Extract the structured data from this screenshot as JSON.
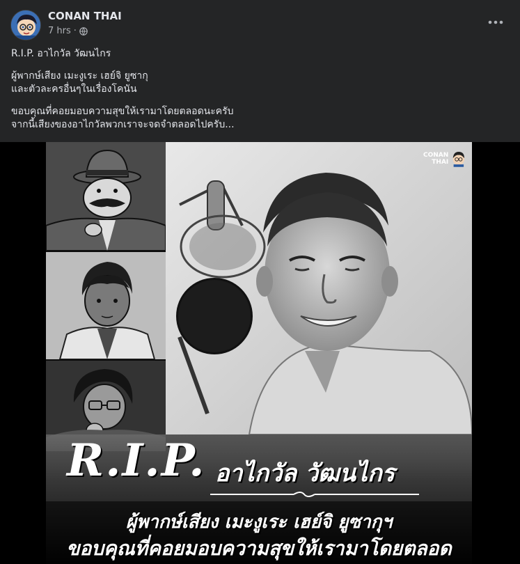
{
  "post": {
    "author": "CONAN THAI",
    "time": "7 hrs",
    "meta_separator": "·",
    "privacy_icon": "globe-icon",
    "more_icon": "more-horizontal-icon",
    "text": {
      "line1": "R.I.P. อาไกวัล วัฒนไกร",
      "line2": "ผู้พากษ์เสียง เมะงูเระ เฮย์จิ ยูซากุ",
      "line3": "และตัวละครอื่นๆในเรื่องโคนัน",
      "line4": "ขอบคุณที่คอยมอบความสุขให้เรามาโดยตลอดนะครับ",
      "line5": "จากนี้เสียงของอาไกวัลพวกเราจะจดจำตลอดไปครับ..."
    }
  },
  "image": {
    "logo_line1": "CONAN",
    "logo_line2": "THAI",
    "rip_text": "R.I.P.",
    "name_text": "อาไกวัล วัฒนไกร",
    "caption1": "ผู้พากษ์เสียง เมะงูเระ เฮย์จิ ยูซากุฯ",
    "caption2": "ขอบคุณที่คอยมอบความสุขให้เรามาโดยตลอด"
  },
  "colors": {
    "background": "#242526",
    "text_primary": "#e4e6eb",
    "text_secondary": "#b0b3b8"
  }
}
